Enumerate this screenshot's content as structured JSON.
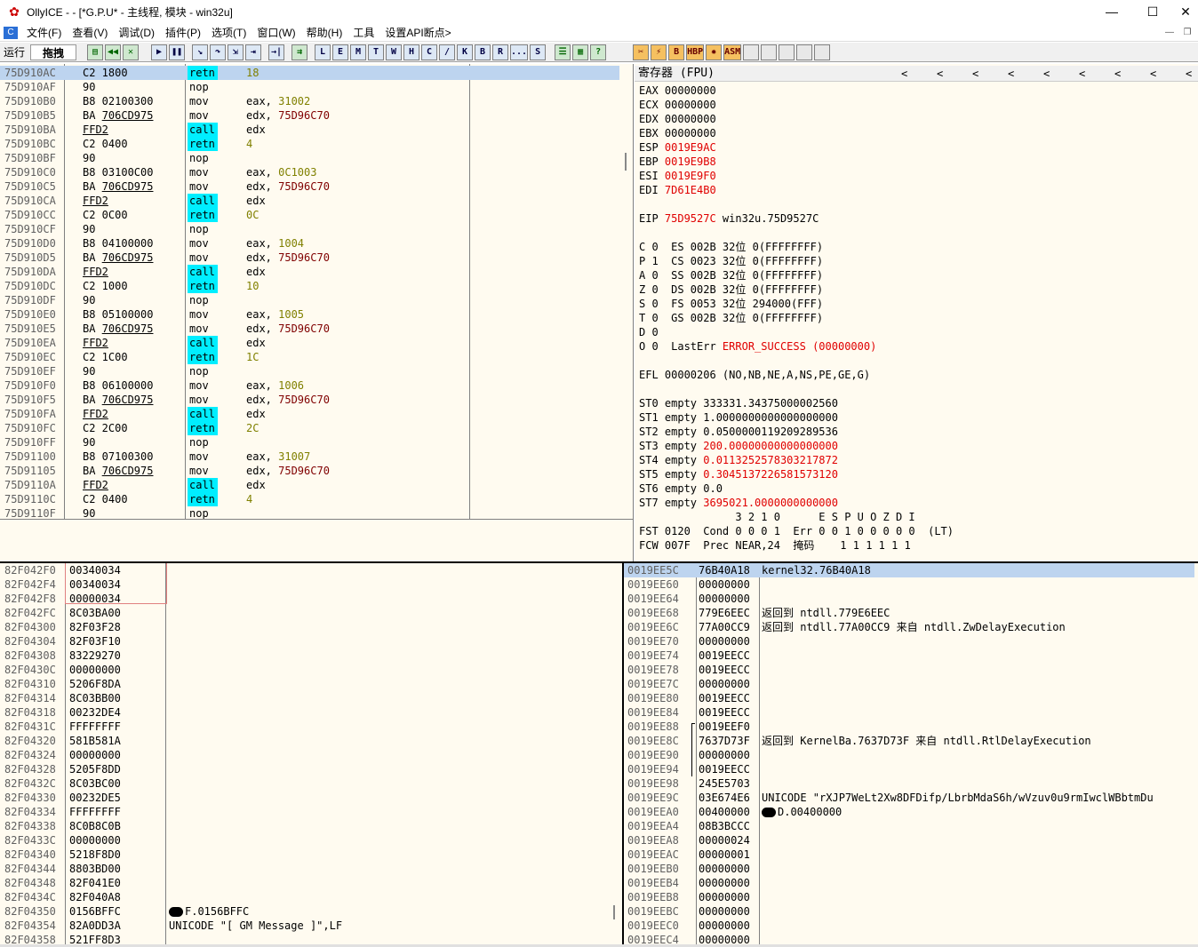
{
  "window": {
    "title": "OllyICE - - [*G.P.U* - 主线程, 模块 - win32u]",
    "min": "—",
    "max": "☐",
    "close": "✕"
  },
  "menu": [
    "文件(F)",
    "查看(V)",
    "调试(D)",
    "插件(P)",
    "选项(T)",
    "窗口(W)",
    "帮助(H)",
    "工具",
    "设置API断点>"
  ],
  "toolbar": {
    "state": "运行",
    "drag": "拖拽",
    "letters": [
      "L",
      "E",
      "M",
      "T",
      "W",
      "H",
      "C",
      "/",
      "K",
      "B",
      "R",
      "...",
      "S"
    ],
    "extra": [
      "HBP",
      "ASM"
    ]
  },
  "cpu": {
    "rows": [
      {
        "a": "75D910AC",
        "h": "C2 1800",
        "m": "retn",
        "o": "18",
        "sel": true
      },
      {
        "a": "75D910AF",
        "h": "90",
        "m": "nop",
        "o": ""
      },
      {
        "a": "75D910B0",
        "h": "B8 02100300",
        "m": "mov",
        "o": "eax, 31002"
      },
      {
        "a": "75D910B5",
        "h": "BA 706CD975",
        "m": "mov",
        "o": "edx, 75D96C70"
      },
      {
        "a": "75D910BA",
        "h": "FFD2",
        "m": "call",
        "o": "edx"
      },
      {
        "a": "75D910BC",
        "h": "C2 0400",
        "m": "retn",
        "o": "4"
      },
      {
        "a": "75D910BF",
        "h": "90",
        "m": "nop",
        "o": ""
      },
      {
        "a": "75D910C0",
        "h": "B8 03100C00",
        "m": "mov",
        "o": "eax, 0C1003"
      },
      {
        "a": "75D910C5",
        "h": "BA 706CD975",
        "m": "mov",
        "o": "edx, 75D96C70"
      },
      {
        "a": "75D910CA",
        "h": "FFD2",
        "m": "call",
        "o": "edx"
      },
      {
        "a": "75D910CC",
        "h": "C2 0C00",
        "m": "retn",
        "o": "0C"
      },
      {
        "a": "75D910CF",
        "h": "90",
        "m": "nop",
        "o": ""
      },
      {
        "a": "75D910D0",
        "h": "B8 04100000",
        "m": "mov",
        "o": "eax, 1004"
      },
      {
        "a": "75D910D5",
        "h": "BA 706CD975",
        "m": "mov",
        "o": "edx, 75D96C70"
      },
      {
        "a": "75D910DA",
        "h": "FFD2",
        "m": "call",
        "o": "edx"
      },
      {
        "a": "75D910DC",
        "h": "C2 1000",
        "m": "retn",
        "o": "10"
      },
      {
        "a": "75D910DF",
        "h": "90",
        "m": "nop",
        "o": ""
      },
      {
        "a": "75D910E0",
        "h": "B8 05100000",
        "m": "mov",
        "o": "eax, 1005"
      },
      {
        "a": "75D910E5",
        "h": "BA 706CD975",
        "m": "mov",
        "o": "edx, 75D96C70"
      },
      {
        "a": "75D910EA",
        "h": "FFD2",
        "m": "call",
        "o": "edx"
      },
      {
        "a": "75D910EC",
        "h": "C2 1C00",
        "m": "retn",
        "o": "1C"
      },
      {
        "a": "75D910EF",
        "h": "90",
        "m": "nop",
        "o": ""
      },
      {
        "a": "75D910F0",
        "h": "B8 06100000",
        "m": "mov",
        "o": "eax, 1006"
      },
      {
        "a": "75D910F5",
        "h": "BA 706CD975",
        "m": "mov",
        "o": "edx, 75D96C70"
      },
      {
        "a": "75D910FA",
        "h": "FFD2",
        "m": "call",
        "o": "edx"
      },
      {
        "a": "75D910FC",
        "h": "C2 2C00",
        "m": "retn",
        "o": "2C"
      },
      {
        "a": "75D910FF",
        "h": "90",
        "m": "nop",
        "o": ""
      },
      {
        "a": "75D91100",
        "h": "B8 07100300",
        "m": "mov",
        "o": "eax, 31007"
      },
      {
        "a": "75D91105",
        "h": "BA 706CD975",
        "m": "mov",
        "o": "edx, 75D96C70"
      },
      {
        "a": "75D9110A",
        "h": "FFD2",
        "m": "call",
        "o": "edx"
      },
      {
        "a": "75D9110C",
        "h": "C2 0400",
        "m": "retn",
        "o": "4"
      },
      {
        "a": "75D9110F",
        "h": "90",
        "m": "nop",
        "o": ""
      }
    ]
  },
  "registers": {
    "title": "寄存器 (FPU)",
    "lines": [
      {
        "t": "EAX 00000000",
        "r": false
      },
      {
        "t": "ECX 00000000",
        "r": false
      },
      {
        "t": "EDX 00000000",
        "r": false
      },
      {
        "t": "EBX 00000000",
        "r": false
      },
      {
        "t": "ESP ",
        "v": "0019E9AC",
        "r": true
      },
      {
        "t": "EBP ",
        "v": "0019E9B8",
        "r": true
      },
      {
        "t": "ESI ",
        "v": "0019E9F0",
        "r": true
      },
      {
        "t": "EDI ",
        "v": "7D61E4B0",
        "r": true
      },
      {
        "t": "",
        "r": false
      },
      {
        "t": "EIP ",
        "v": "75D9527C",
        "s": " win32u.75D9527C",
        "r": true
      },
      {
        "t": "",
        "r": false
      },
      {
        "t": "C 0  ES 002B 32位 0(FFFFFFFF)",
        "r": false
      },
      {
        "t": "P 1  CS 0023 32位 0(FFFFFFFF)",
        "r": false
      },
      {
        "t": "A 0  SS 002B 32位 0(FFFFFFFF)",
        "r": false
      },
      {
        "t": "Z 0  DS 002B 32位 0(FFFFFFFF)",
        "r": false
      },
      {
        "t": "S 0  FS 0053 32位 294000(FFF)",
        "r": false
      },
      {
        "t": "T 0  GS 002B 32位 0(FFFFFFFF)",
        "r": false
      },
      {
        "t": "D 0",
        "r": false
      },
      {
        "t": "O 0  LastErr ",
        "v": "ERROR_SUCCESS (00000000)",
        "r": true
      },
      {
        "t": "",
        "r": false
      },
      {
        "t": "EFL 00000206 (NO,NB,NE,A,NS,PE,GE,G)",
        "r": false
      },
      {
        "t": "",
        "r": false
      },
      {
        "t": "ST0 empty 333331.34375000002560",
        "r": false
      },
      {
        "t": "ST1 empty 1.0000000000000000000",
        "r": false
      },
      {
        "t": "ST2 empty 0.0500000119209289536",
        "r": false
      },
      {
        "t": "ST3 empty ",
        "v": "200.00000000000000000",
        "r": true
      },
      {
        "t": "ST4 empty ",
        "v": "0.0113252578303217872",
        "r": true
      },
      {
        "t": "ST5 empty ",
        "v": "0.3045137226581573120",
        "r": true
      },
      {
        "t": "ST6 empty 0.0",
        "r": false
      },
      {
        "t": "ST7 empty ",
        "v": "3695021.0000000000000",
        "r": true
      },
      {
        "t": "               3 2 1 0      E S P U O Z D I",
        "r": false
      },
      {
        "t": "FST 0120  Cond 0 0 0 1  Err 0 0 1 0 0 0 0 0  (LT)",
        "r": false
      },
      {
        "t": "FCW 007F  Prec NEAR,24  掩码    1 1 1 1 1 1",
        "r": false
      }
    ]
  },
  "dump": {
    "rows": [
      {
        "a": "82F042F0",
        "v": "00340034",
        "c": ""
      },
      {
        "a": "82F042F4",
        "v": "00340034",
        "c": ""
      },
      {
        "a": "82F042F8",
        "v": "00000034",
        "c": ""
      },
      {
        "a": "82F042FC",
        "v": "8C03BA00",
        "c": ""
      },
      {
        "a": "82F04300",
        "v": "82F03F28",
        "c": ""
      },
      {
        "a": "82F04304",
        "v": "82F03F10",
        "c": ""
      },
      {
        "a": "82F04308",
        "v": "83229270",
        "c": ""
      },
      {
        "a": "82F0430C",
        "v": "00000000",
        "c": ""
      },
      {
        "a": "82F04310",
        "v": "5206F8DA",
        "c": ""
      },
      {
        "a": "82F04314",
        "v": "8C03BB00",
        "c": ""
      },
      {
        "a": "82F04318",
        "v": "00232DE4",
        "c": ""
      },
      {
        "a": "82F0431C",
        "v": "FFFFFFFF",
        "c": ""
      },
      {
        "a": "82F04320",
        "v": "581B581A",
        "c": ""
      },
      {
        "a": "82F04324",
        "v": "00000000",
        "c": ""
      },
      {
        "a": "82F04328",
        "v": "5205F8DD",
        "c": ""
      },
      {
        "a": "82F0432C",
        "v": "8C03BC00",
        "c": ""
      },
      {
        "a": "82F04330",
        "v": "00232DE5",
        "c": ""
      },
      {
        "a": "82F04334",
        "v": "FFFFFFFF",
        "c": ""
      },
      {
        "a": "82F04338",
        "v": "8C0B8C0B",
        "c": ""
      },
      {
        "a": "82F0433C",
        "v": "00000000",
        "c": ""
      },
      {
        "a": "82F04340",
        "v": "5218F8D0",
        "c": ""
      },
      {
        "a": "82F04344",
        "v": "8803BD00",
        "c": ""
      },
      {
        "a": "82F04348",
        "v": "82F041E0",
        "c": ""
      },
      {
        "a": "82F0434C",
        "v": "82F040A8",
        "c": ""
      },
      {
        "a": "82F04350",
        "v": "0156BFFC",
        "c": "F.0156BFFC",
        "blob": true
      },
      {
        "a": "82F04354",
        "v": "82A0DD3A",
        "c": "UNICODE \"[ GM Message ]\",LF"
      },
      {
        "a": "82F04358",
        "v": "521FF8D3",
        "c": ""
      }
    ]
  },
  "stack": {
    "rows": [
      {
        "a": "0019EE5C",
        "v": "76B40A18",
        "c": "kernel32.76B40A18",
        "sel": true
      },
      {
        "a": "0019EE60",
        "v": "00000000",
        "c": ""
      },
      {
        "a": "0019EE64",
        "v": "00000000",
        "c": ""
      },
      {
        "a": "0019EE68",
        "v": "779E6EEC",
        "c": "返回到 ntdll.779E6EEC"
      },
      {
        "a": "0019EE6C",
        "v": "77A00CC9",
        "c": "返回到 ntdll.77A00CC9 来自 ntdll.ZwDelayExecution"
      },
      {
        "a": "0019EE70",
        "v": "00000000",
        "c": ""
      },
      {
        "a": "0019EE74",
        "v": "0019EECC",
        "c": ""
      },
      {
        "a": "0019EE78",
        "v": "0019EECC",
        "c": ""
      },
      {
        "a": "0019EE7C",
        "v": "00000000",
        "c": ""
      },
      {
        "a": "0019EE80",
        "v": "0019EECC",
        "c": ""
      },
      {
        "a": "0019EE84",
        "v": "0019EECC",
        "c": ""
      },
      {
        "a": "0019EE88",
        "v": "0019EEF0",
        "c": ""
      },
      {
        "a": "0019EE8C",
        "v": "7637D73F",
        "c": "返回到 KernelBa.7637D73F 来自 ntdll.RtlDelayExecution"
      },
      {
        "a": "0019EE90",
        "v": "00000000",
        "c": ""
      },
      {
        "a": "0019EE94",
        "v": "0019EECC",
        "c": ""
      },
      {
        "a": "0019EE98",
        "v": "245E5703",
        "c": ""
      },
      {
        "a": "0019EE9C",
        "v": "03E674E6",
        "c": "UNICODE \"rXJP7WeLt2Xw8DFDifp/LbrbMdaS6h/wVzuv0u9rmIwclWBbtmDu"
      },
      {
        "a": "0019EEA0",
        "v": "00400000",
        "c": "D.00400000",
        "blob": true
      },
      {
        "a": "0019EEA4",
        "v": "08B3BCCC",
        "c": ""
      },
      {
        "a": "0019EEA8",
        "v": "00000024",
        "c": ""
      },
      {
        "a": "0019EEAC",
        "v": "00000001",
        "c": ""
      },
      {
        "a": "0019EEB0",
        "v": "00000000",
        "c": ""
      },
      {
        "a": "0019EEB4",
        "v": "00000000",
        "c": ""
      },
      {
        "a": "0019EEB8",
        "v": "00000000",
        "c": ""
      },
      {
        "a": "0019EEBC",
        "v": "00000000",
        "c": ""
      },
      {
        "a": "0019EEC0",
        "v": "00000000",
        "c": ""
      },
      {
        "a": "0019EEC4",
        "v": "00000000",
        "c": ""
      }
    ]
  }
}
